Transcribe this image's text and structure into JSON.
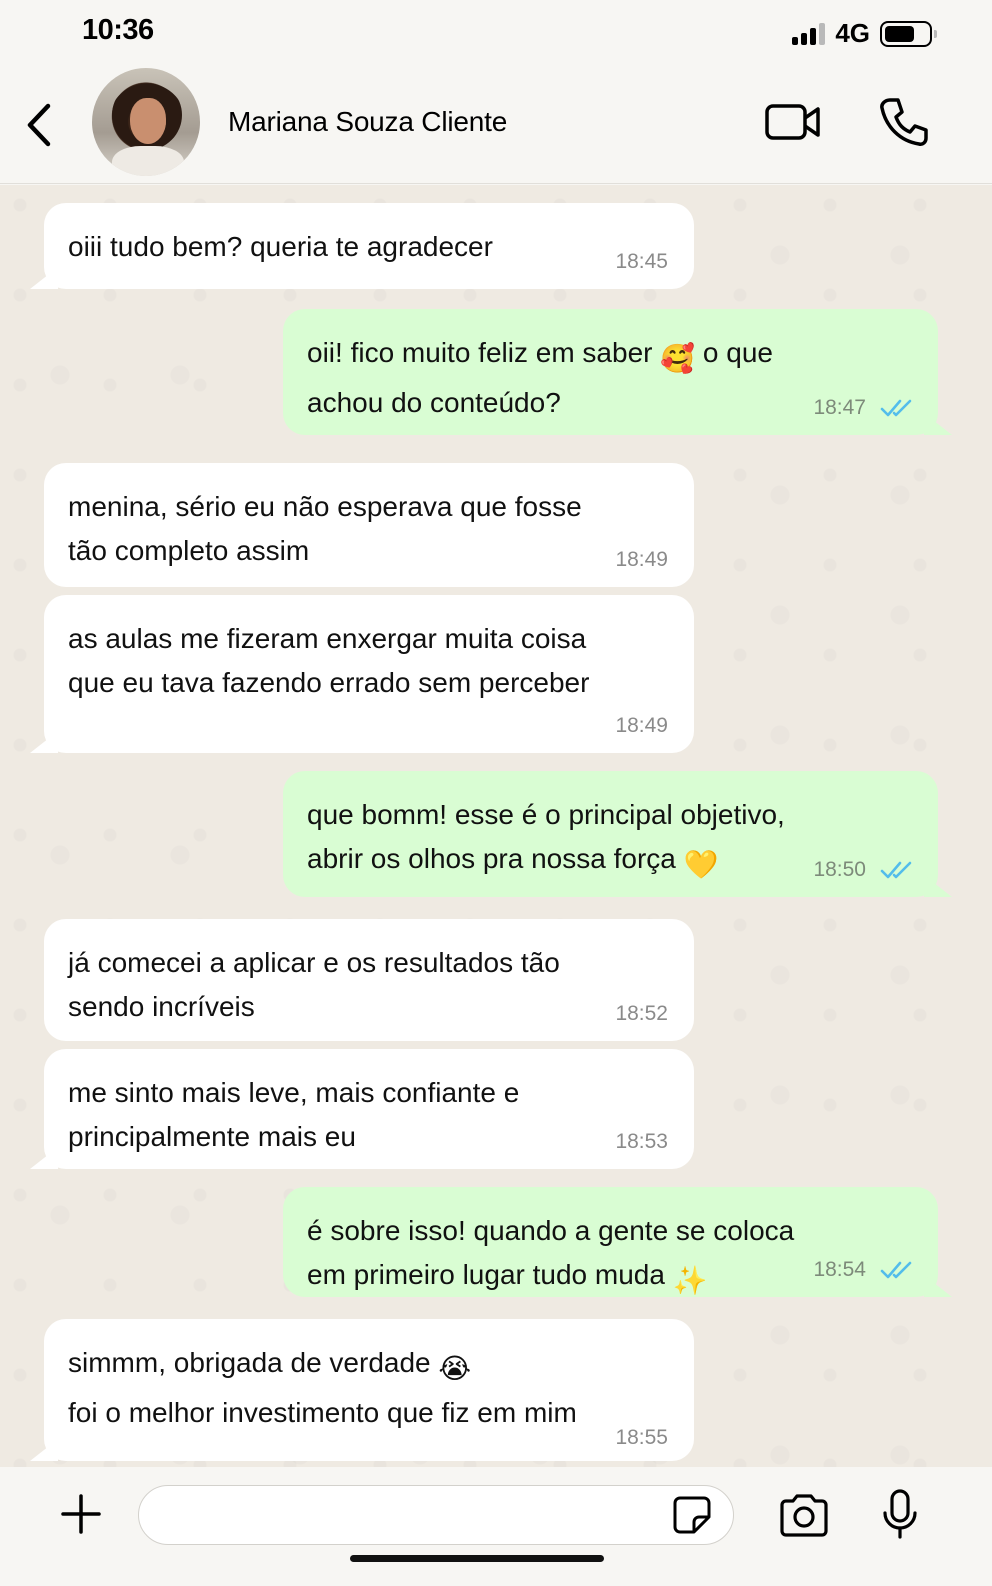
{
  "status_bar": {
    "time": "10:36",
    "network": "4G",
    "icons": [
      "signal-icon",
      "battery-icon"
    ]
  },
  "header": {
    "contact_name": "Mariana Souza Cliente",
    "icons": [
      "back-icon",
      "avatar",
      "video-call-icon",
      "voice-call-icon"
    ]
  },
  "messages": [
    {
      "direction": "in",
      "text": "oiii tudo bem? queria te agradecer",
      "time": "18:45"
    },
    {
      "direction": "out",
      "text_before": "oii! fico muito feliz em saber ",
      "emoji": "🥰",
      "text_after": "  o que\nachou do conteúdo?",
      "time": "18:47",
      "read": true
    },
    {
      "direction": "in",
      "text": "menina, sério eu não esperava que fosse\ntão completo assim",
      "time": "18:49"
    },
    {
      "direction": "in",
      "text": "as aulas me fizeram enxergar muita coisa\nque eu tava fazendo errado sem perceber",
      "time": "18:49"
    },
    {
      "direction": "out",
      "text_before": "que bomm! esse é o principal objetivo,\nabrir os olhos pra nossa força ",
      "emoji": "💛",
      "text_after": "",
      "time": "18:50",
      "read": true
    },
    {
      "direction": "in",
      "text": "já comecei a aplicar e os resultados tão\nsendo incríveis",
      "time": "18:52"
    },
    {
      "direction": "in",
      "text": "me sinto mais leve, mais confiante e\nprincipalmente mais eu",
      "time": "18:53"
    },
    {
      "direction": "out",
      "text_before": "é sobre isso! quando a gente se coloca\nem primeiro lugar tudo muda ",
      "emoji": "✨",
      "text_after": "",
      "time": "18:54",
      "read": true
    },
    {
      "direction": "in",
      "text_before": "simmm, obrigada de verdade ",
      "emoji": "😭",
      "text_after": "\nfoi o melhor investimento que fiz em mim",
      "time": "18:55"
    }
  ],
  "input_bar": {
    "placeholder": "",
    "icons": [
      "plus-icon",
      "sticker-icon",
      "camera-icon",
      "microphone-icon"
    ]
  },
  "colors": {
    "incoming_bubble": "#ffffff",
    "outgoing_bubble": "#d9fdd3",
    "chat_background": "#efeae2",
    "read_ticks": "#53bdeb"
  }
}
